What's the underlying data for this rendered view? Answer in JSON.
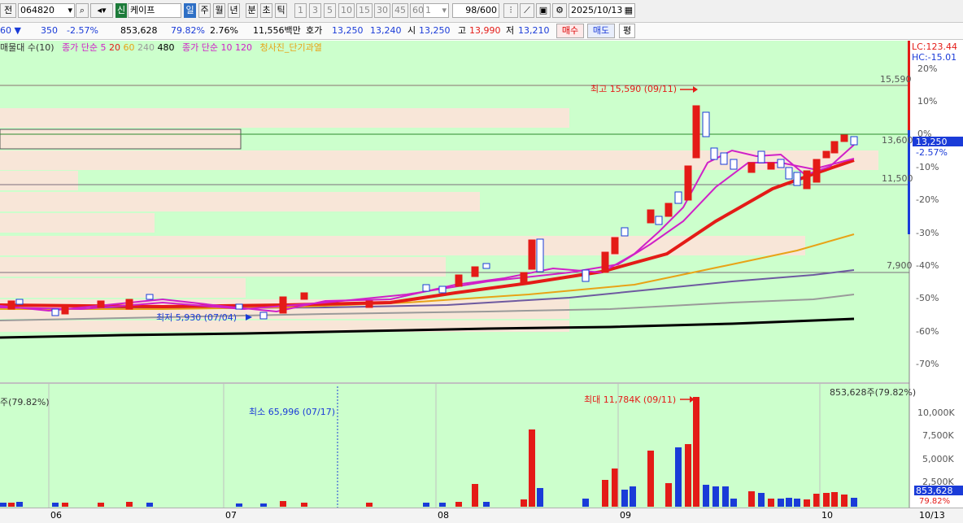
{
  "toolbar": {
    "prev_label": "전",
    "code": "064820",
    "market_badge": "신",
    "stock_name": "케이프",
    "periods": [
      "일",
      "주",
      "월",
      "년",
      "분",
      "초",
      "틱"
    ],
    "active_period": "일",
    "intervals": [
      "1",
      "3",
      "5",
      "10",
      "15",
      "30",
      "45",
      "60"
    ],
    "count_value": "1",
    "page_value": "98",
    "page_total": "/600",
    "date": "2025/10/13"
  },
  "quote": {
    "change_prefix": "60 ▼",
    "change": "350",
    "change_pct": "-2.57%",
    "volume": "853,628",
    "volume_ratio": "79.82%",
    "turnover_rate": "2.76%",
    "trade_value": "11,556백만",
    "ask_label": "호가",
    "ask_sell": "13,250",
    "ask_buy": "13,240",
    "open_label": "시",
    "open": "13,250",
    "high_label": "고",
    "high": "13,990",
    "low_label": "저",
    "low": "13,210",
    "buy_label": "매수",
    "sell_label": "매도",
    "flat_label": "평"
  },
  "legend": {
    "vol_profile": "매물대 수(10)",
    "ma_close_label": "종가 단순",
    "ma_periods": [
      {
        "text": "5",
        "color": "#d020c8"
      },
      {
        "text": "20",
        "color": "#e41b17"
      },
      {
        "text": "60",
        "color": "#e8a317"
      },
      {
        "text": "240",
        "color": "#9a9a9a"
      },
      {
        "text": "480",
        "color": "#000000"
      }
    ],
    "vol_ma_label": "종가 단순",
    "vol_ma_periods": [
      {
        "text": "10",
        "color": "#d020c8"
      },
      {
        "text": "120",
        "color": "#d020c8"
      }
    ],
    "signal": "청사진_단기과열"
  },
  "price_axis": {
    "lc": "LC:123.44",
    "hc": "HC:-15.01",
    "pct_ticks": [
      "20%",
      "10%",
      "0%",
      "-10%",
      "-20%",
      "-30%",
      "-40%",
      "-50%",
      "-60%",
      "-70%"
    ],
    "current_price": "13,250",
    "current_pct": "-2.57%"
  },
  "levels": {
    "l15590": "15,590",
    "l13600": "13,600",
    "l11500": "11,500",
    "l7900": "7,900"
  },
  "annotations": {
    "high": "최고 15,590 (09/11)",
    "low": "최저 5,930 (07/04)",
    "vol_max": "최대 11,784K (09/11)",
    "vol_min": "최소 65,996 (07/17)",
    "vol_label_left": "주(79.82%)",
    "vol_label_right": "853,628주(79.82%)"
  },
  "volume_axis": {
    "ticks": [
      "10,000K",
      "7,500K",
      "5,000K",
      "2,500K"
    ],
    "current": "853,628",
    "current_pct": "79.82%"
  },
  "date_axis": {
    "labels": [
      "06",
      "07",
      "08",
      "09",
      "10"
    ],
    "last": "10/13"
  },
  "colors": {
    "chart_bg": "#ccffcc",
    "up": "#e41b17",
    "down": "#1a3bd8",
    "ma5": "#d020c8",
    "ma20": "#e41b17",
    "ma60": "#e8a317",
    "ma240": "#9a9a9a",
    "ma480": "#000000"
  },
  "chart_data": {
    "type": "candlestick",
    "price_levels": [
      15590,
      13600,
      11500,
      7900
    ],
    "high_price": 15590,
    "low_price": 5930,
    "current_price": 13250,
    "volume_max": 11784000,
    "volume_current": 853628
  }
}
